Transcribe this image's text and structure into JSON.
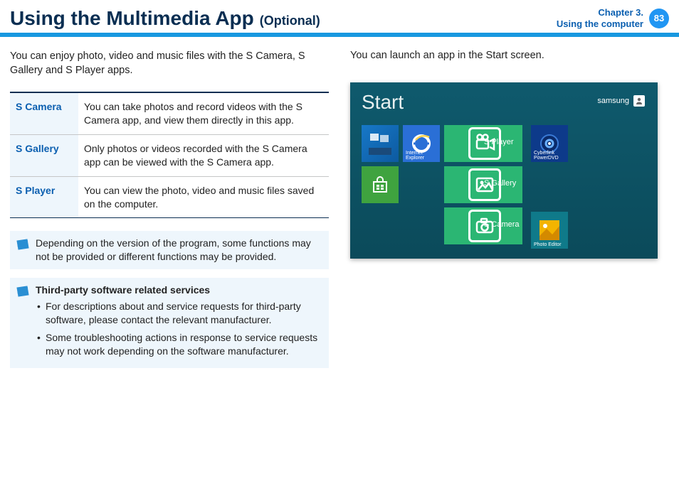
{
  "header": {
    "title": "Using the Multimedia App",
    "subtitle": "(Optional)",
    "chapter_line1": "Chapter 3.",
    "chapter_line2": "Using the computer",
    "page": "83"
  },
  "left": {
    "intro": "You can enjoy photo, video and music files with the S Camera, S Gallery and S Player apps.",
    "apps": [
      {
        "name": "S Camera",
        "desc": "You can take photos and record videos with the S Camera app, and view them directly in this app."
      },
      {
        "name": "S Gallery",
        "desc": "Only photos or videos recorded with the S Camera app can be viewed with the S Camera app."
      },
      {
        "name": "S Player",
        "desc": "You can view the photo, video and music files saved on the computer."
      }
    ],
    "note1": "Depending on the version of the program, some functions may not be provided or different functions may be provided.",
    "note2": {
      "heading": "Third-party software related services",
      "items": [
        "For descriptions about and service requests for third-party software, please contact the relevant manufacturer.",
        "Some troubleshooting actions in response to service requests may not work depending on the software manufacturer."
      ]
    }
  },
  "right": {
    "intro": "You can launch an app in the Start screen.",
    "start": {
      "title": "Start",
      "user": "samsung",
      "tiles": {
        "ie": "Internet Explorer",
        "splayer": "S Player",
        "sgallery": "S Gallery",
        "scamera": "S Camera",
        "cyber": "Cyberlink PowerDVD",
        "photo": "Photo Editor"
      }
    }
  }
}
